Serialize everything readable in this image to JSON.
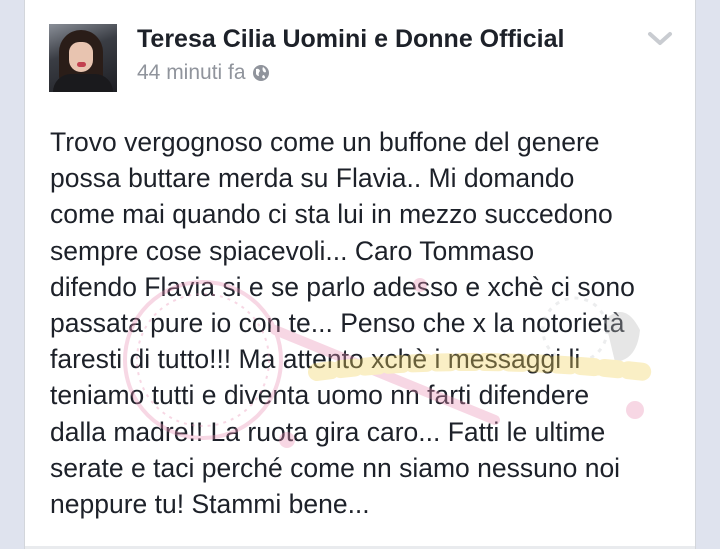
{
  "post": {
    "author": "Teresa Cilia Uomini e Donne Official",
    "timestamp": "44 minuti fa",
    "privacy_icon": "globe-icon",
    "options_icon": "chevron-down-icon",
    "avatar_icon": "profile-photo",
    "text_lines": [
      "Trovo vergognoso come un buffone del genere",
      "possa buttare merda su Flavia.. Mi domando",
      "come mai quando ci sta lui in mezzo succedono",
      "sempre cose spiacevoli... Caro Tommaso",
      "difendo Flavia si e se parlo adesso e xchè ci sono",
      "passata pure io con te... Penso che x la notorietà",
      "faresti di tutto!!! Ma attento xchè i messaggi li",
      "teniamo tutti e diventa uomo nn farti difendere",
      "dalla madre!! La ruota gira caro... Fatti le ultime",
      "serate e taci perché come nn siamo nessuno noi",
      "neppure tu! Stammi bene..."
    ]
  },
  "colors": {
    "text": "#1d2129",
    "meta": "#90949c",
    "background": "#dfe3ee",
    "card": "#ffffff",
    "watermark_pink": "#e98fb4",
    "watermark_yellow": "#f3d35c"
  }
}
